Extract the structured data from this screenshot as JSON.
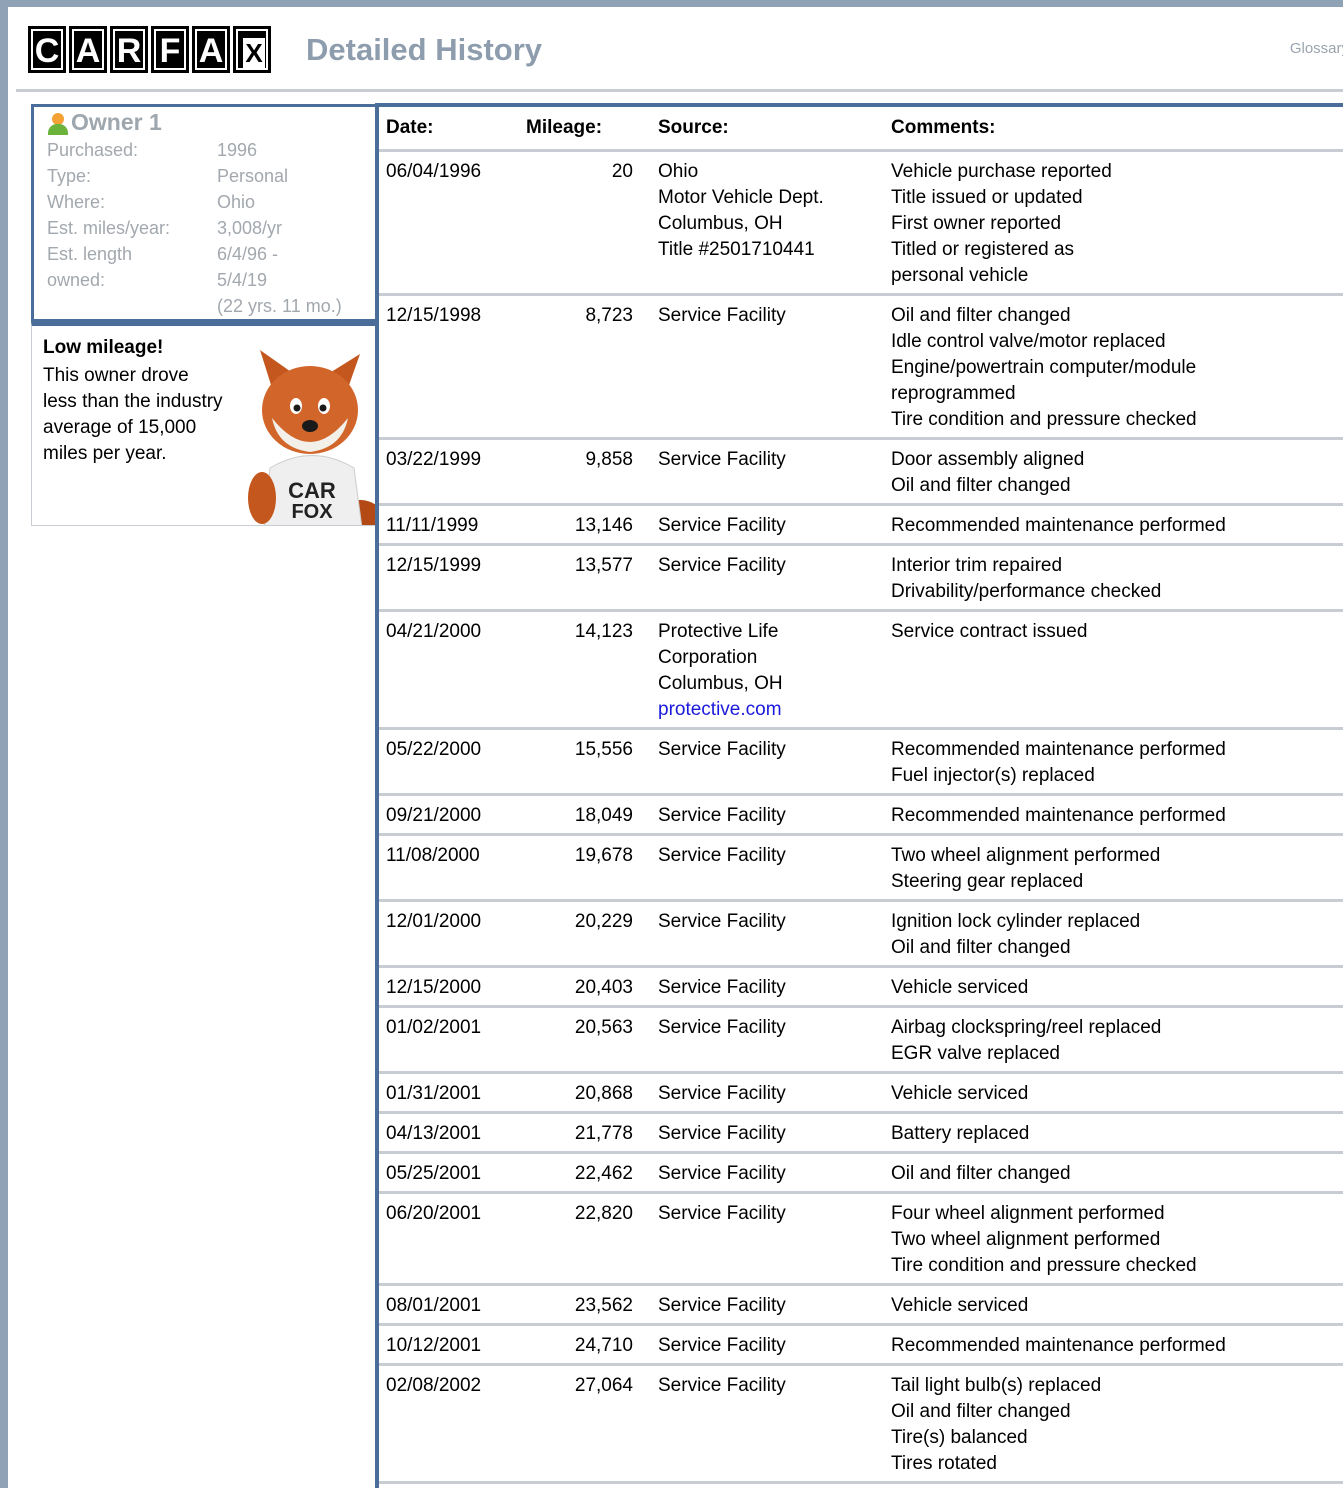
{
  "header": {
    "logo_letters": [
      "C",
      "A",
      "R",
      "F",
      "A",
      "X"
    ],
    "title": "Detailed History",
    "glossary_link": "Glossary"
  },
  "owner": {
    "title": "Owner 1",
    "icon": "person-icon",
    "fields": [
      {
        "label": "Purchased:",
        "value": "1996"
      },
      {
        "label": "Type:",
        "value": "Personal"
      },
      {
        "label": "Where:",
        "value": "Ohio"
      },
      {
        "label": "Est. miles/year:",
        "value": "3,008/yr"
      },
      {
        "label": "Est. length",
        "value": "6/4/96 -"
      },
      {
        "label": "owned:",
        "value": "5/4/19"
      }
    ],
    "length_note": "(22 yrs. 11 mo.)"
  },
  "note": {
    "heading": "Low mileage!",
    "text": "This owner drove less than the industry average of 15,000 miles per year.",
    "mascot_shirt": "CAR FOX"
  },
  "table": {
    "headers": {
      "date": "Date:",
      "mileage": "Mileage:",
      "source": "Source:",
      "comments": "Comments:"
    },
    "rows": [
      {
        "date": "06/04/1996",
        "mileage": "20",
        "source": [
          "Ohio",
          "Motor Vehicle Dept.",
          "Columbus, OH",
          "Title #2501710441"
        ],
        "comments": [
          "Vehicle purchase reported",
          "Title issued or updated",
          "First owner reported",
          "Titled or registered as",
          "personal vehicle"
        ]
      },
      {
        "date": "12/15/1998",
        "mileage": "8,723",
        "source": [
          "Service Facility"
        ],
        "comments": [
          "Oil and filter changed",
          "Idle control valve/motor replaced",
          "Engine/powertrain computer/module",
          "reprogrammed",
          "Tire condition and pressure checked"
        ]
      },
      {
        "date": "03/22/1999",
        "mileage": "9,858",
        "source": [
          "Service Facility"
        ],
        "comments": [
          "Door assembly aligned",
          "Oil and filter changed"
        ]
      },
      {
        "date": "11/11/1999",
        "mileage": "13,146",
        "source": [
          "Service Facility"
        ],
        "comments": [
          "Recommended maintenance performed"
        ]
      },
      {
        "date": "12/15/1999",
        "mileage": "13,577",
        "source": [
          "Service Facility"
        ],
        "comments": [
          "Interior trim repaired",
          "Drivability/performance checked"
        ]
      },
      {
        "date": "04/21/2000",
        "mileage": "14,123",
        "source": [
          "Protective Life",
          "Corporation",
          "Columbus, OH"
        ],
        "source_link": "protective.com",
        "comments": [
          "Service contract issued"
        ]
      },
      {
        "date": "05/22/2000",
        "mileage": "15,556",
        "source": [
          "Service Facility"
        ],
        "comments": [
          "Recommended maintenance performed",
          "Fuel injector(s) replaced"
        ]
      },
      {
        "date": "09/21/2000",
        "mileage": "18,049",
        "source": [
          "Service Facility"
        ],
        "comments": [
          "Recommended maintenance performed"
        ]
      },
      {
        "date": "11/08/2000",
        "mileage": "19,678",
        "source": [
          "Service Facility"
        ],
        "comments": [
          "Two wheel alignment performed",
          "Steering gear replaced"
        ]
      },
      {
        "date": "12/01/2000",
        "mileage": "20,229",
        "source": [
          "Service Facility"
        ],
        "comments": [
          "Ignition lock cylinder replaced",
          "Oil and filter changed"
        ]
      },
      {
        "date": "12/15/2000",
        "mileage": "20,403",
        "source": [
          "Service Facility"
        ],
        "comments": [
          "Vehicle serviced"
        ]
      },
      {
        "date": "01/02/2001",
        "mileage": "20,563",
        "source": [
          "Service Facility"
        ],
        "comments": [
          "Airbag clockspring/reel replaced",
          "EGR valve replaced"
        ]
      },
      {
        "date": "01/31/2001",
        "mileage": "20,868",
        "source": [
          "Service Facility"
        ],
        "comments": [
          "Vehicle serviced"
        ]
      },
      {
        "date": "04/13/2001",
        "mileage": "21,778",
        "source": [
          "Service Facility"
        ],
        "comments": [
          "Battery replaced"
        ]
      },
      {
        "date": "05/25/2001",
        "mileage": "22,462",
        "source": [
          "Service Facility"
        ],
        "comments": [
          "Oil and filter changed"
        ]
      },
      {
        "date": "06/20/2001",
        "mileage": "22,820",
        "source": [
          "Service Facility"
        ],
        "comments": [
          "Four wheel alignment performed",
          "Two wheel alignment performed",
          "Tire condition and pressure checked"
        ]
      },
      {
        "date": "08/01/2001",
        "mileage": "23,562",
        "source": [
          "Service Facility"
        ],
        "comments": [
          "Vehicle serviced"
        ]
      },
      {
        "date": "10/12/2001",
        "mileage": "24,710",
        "source": [
          "Service Facility"
        ],
        "comments": [
          "Recommended maintenance performed"
        ]
      },
      {
        "date": "02/08/2002",
        "mileage": "27,064",
        "source": [
          "Service Facility"
        ],
        "comments": [
          "Tail light bulb(s) replaced",
          "Oil and filter changed",
          "Tire(s) balanced",
          "Tires rotated"
        ]
      }
    ]
  }
}
